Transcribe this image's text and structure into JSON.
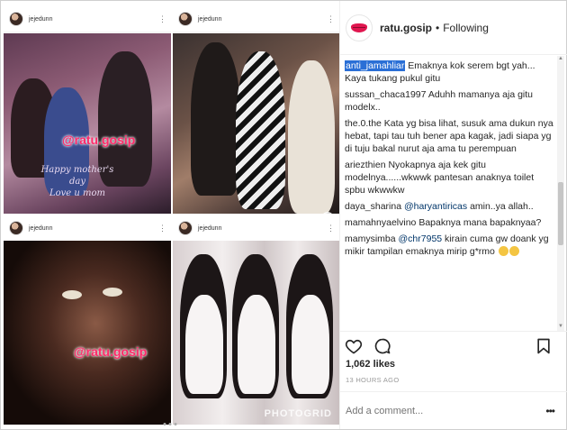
{
  "collage": {
    "tile_user": "jejedunn",
    "watermark": "@ratu.gosip",
    "greeting_lines": [
      "Happy mother's",
      "day",
      "Love u mom"
    ],
    "grid_brand": "PHOTOGRID"
  },
  "panel": {
    "username": "ratu.gosip",
    "separator": "•",
    "follow_state": "Following",
    "comments": [
      {
        "author": "anti_jamahliar",
        "text": "Emaknya kok serem bgt yah... Kaya tukang pukul gitu",
        "highlighted": true
      },
      {
        "author": "sussan_chaca1997",
        "text": "Aduhh mamanya aja gitu modelx.."
      },
      {
        "author": "the.0.the",
        "text": "Kata yg bisa lihat, susuk ama dukun nya hebat, tapi tau tuh bener apa kagak, jadi siapa yg di tuju bakal nurut aja ama tu perempuan"
      },
      {
        "author": "ariezthien",
        "text": "Nyokapnya aja kek gitu modelnya......wkwwk pantesan anaknya toilet spbu wkwwkw"
      },
      {
        "author": "daya_sharina",
        "mention": "@haryantiricas",
        "text": "amin..ya allah.."
      },
      {
        "author": "mamahnyaelvino",
        "text": "Bapaknya mana bapaknyaa?"
      },
      {
        "author": "mamysimba",
        "mention": "@chr7955",
        "text": "kirain cuma gw doank yg mikir tampilan emaknya mirip g*rmo"
      }
    ],
    "likes": "1,062 likes",
    "timestamp": "13 HOURS AGO",
    "add_comment_placeholder": "Add a comment...",
    "more": "•••"
  },
  "icons": {
    "like": "heart-icon",
    "comment": "comment-bubble-icon",
    "save": "bookmark-icon",
    "avatar": "lips-logo-icon"
  },
  "colors": {
    "accent_pink": "#ff2a6a",
    "highlight_blue": "#2a6fd6",
    "mention_blue": "#003569",
    "muted_gray": "#999999"
  }
}
